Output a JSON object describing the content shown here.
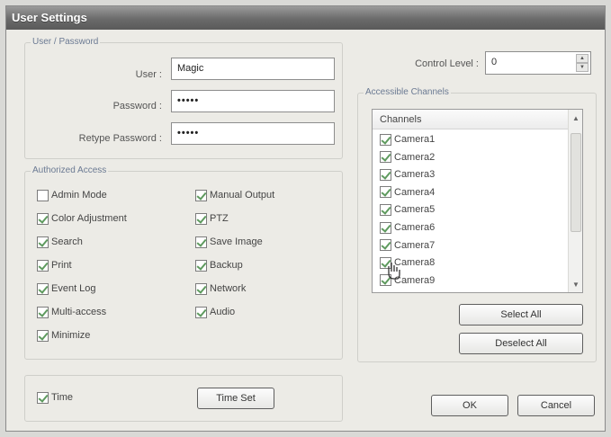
{
  "window": {
    "title": "User Settings"
  },
  "user_password": {
    "legend": "User / Password",
    "user_label": "User :",
    "user_value": "Magic",
    "password_label": "Password :",
    "password_value": "•••••",
    "retype_label": "Retype Password :",
    "retype_value": "•••••"
  },
  "authorized_access": {
    "legend": "Authorized Access",
    "items": [
      {
        "label": "Admin Mode",
        "checked": false
      },
      {
        "label": "Manual Output",
        "checked": true
      },
      {
        "label": "Color Adjustment",
        "checked": true
      },
      {
        "label": "PTZ",
        "checked": true
      },
      {
        "label": "Search",
        "checked": true
      },
      {
        "label": "Save Image",
        "checked": true
      },
      {
        "label": "Print",
        "checked": true
      },
      {
        "label": "Backup",
        "checked": true
      },
      {
        "label": "Event Log",
        "checked": true
      },
      {
        "label": "Network",
        "checked": true
      },
      {
        "label": "Multi-access",
        "checked": true
      },
      {
        "label": "Audio",
        "checked": true
      },
      {
        "label": "Minimize",
        "checked": true
      }
    ]
  },
  "time": {
    "label": "Time",
    "checked": true,
    "button": "Time Set"
  },
  "control_level": {
    "label": "Control Level :",
    "value": "0"
  },
  "channels": {
    "legend": "Accessible Channels",
    "header": "Channels",
    "items": [
      {
        "label": "Camera1",
        "checked": true
      },
      {
        "label": "Camera2",
        "checked": true
      },
      {
        "label": "Camera3",
        "checked": true
      },
      {
        "label": "Camera4",
        "checked": true
      },
      {
        "label": "Camera5",
        "checked": true
      },
      {
        "label": "Camera6",
        "checked": true
      },
      {
        "label": "Camera7",
        "checked": true
      },
      {
        "label": "Camera8",
        "checked": true
      },
      {
        "label": "Camera9",
        "checked": true
      }
    ],
    "select_all": "Select All",
    "deselect_all": "Deselect All"
  },
  "buttons": {
    "ok": "OK",
    "cancel": "Cancel"
  },
  "colors": {
    "title_bar": "#6a6a6a",
    "legend_text": "#6b7a93",
    "check_mark": "#5e9a5e"
  }
}
